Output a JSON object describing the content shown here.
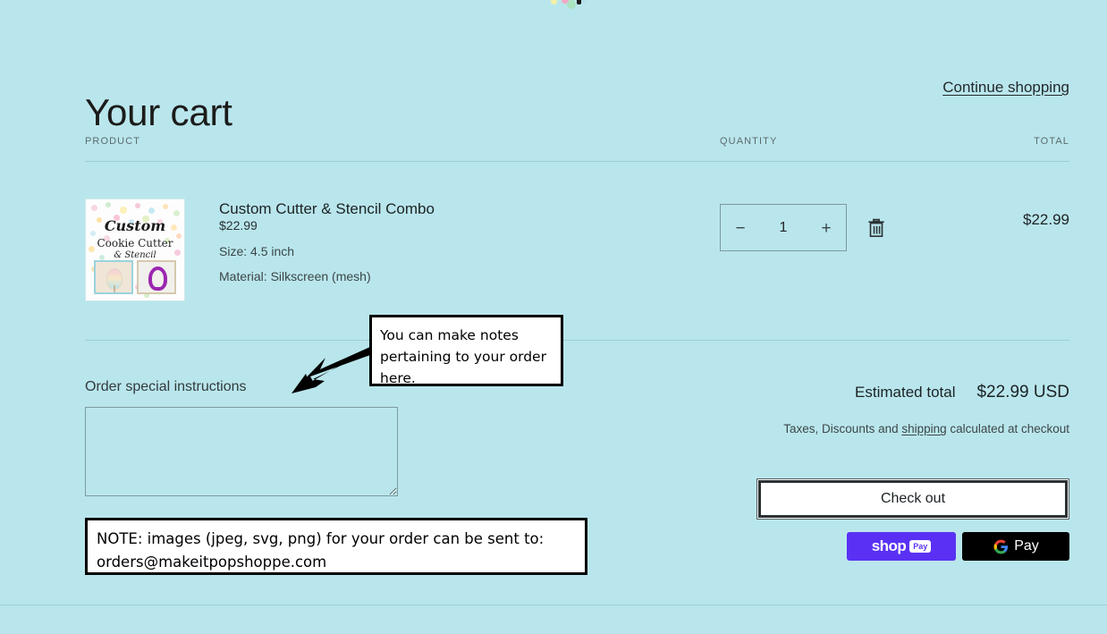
{
  "page": {
    "background_color": "#b9e6ec",
    "title": "Your cart",
    "continue_shopping": "Continue shopping"
  },
  "table_headers": {
    "product": "PRODUCT",
    "quantity": "QUANTITY",
    "total": "TOTAL"
  },
  "line_items": [
    {
      "thumbnail": {
        "script_text": "Custom",
        "line2": "Cookie Cutter",
        "line3": "& Stencil",
        "alt": "Custom Cookie Cutter & Stencil product image"
      },
      "title": "Custom Cutter & Stencil Combo",
      "price": "$22.99",
      "options": [
        "Size: 4.5 inch",
        "Material: Silkscreen (mesh)"
      ],
      "quantity": "1",
      "decrease_label": "−",
      "increase_label": "+",
      "remove_label": "trash-icon",
      "line_total": "$22.99"
    }
  ],
  "instructions": {
    "label": "Order special instructions",
    "value": "",
    "placeholder": ""
  },
  "totals": {
    "estimated_total_label": "Estimated total",
    "estimated_total_value": "$22.99 USD",
    "tax_note_prefix": "Taxes, Discounts and ",
    "tax_note_link": "shipping",
    "tax_note_suffix": " calculated at checkout"
  },
  "actions": {
    "checkout_label": "Check out",
    "shop_pay": {
      "word": "shop",
      "badge": "Pay",
      "color": "#5a31f4"
    },
    "google_pay": {
      "word": "Pay",
      "color": "#000000"
    }
  },
  "annotations": {
    "callout": "You can make notes pertaining to your order here.",
    "note_line1": "NOTE: images (jpeg, svg, png) for your order can be sent to:",
    "note_line2": "orders@makeitpopshoppe.com"
  }
}
